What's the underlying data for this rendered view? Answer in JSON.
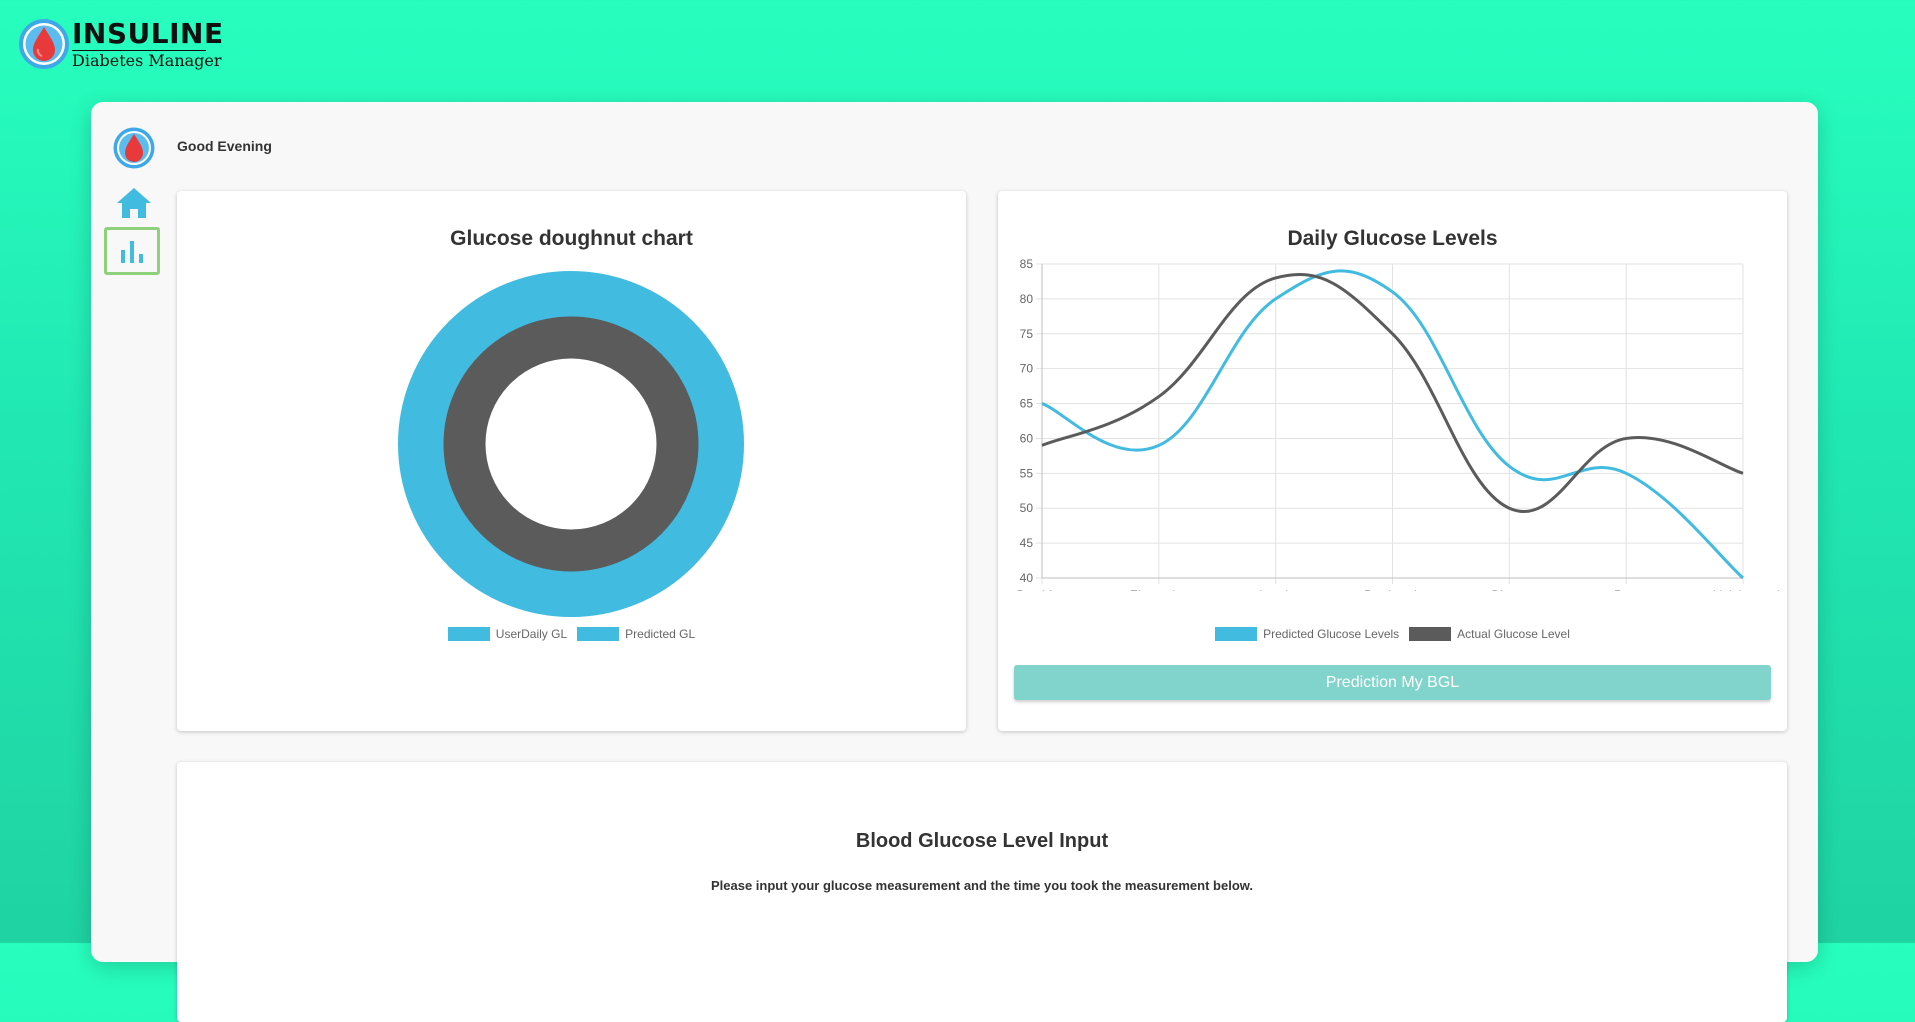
{
  "brand": {
    "title": "INSULINE",
    "subtitle": "Diabetes Manager",
    "logo_icon": "blood-drop-icon"
  },
  "header": {
    "greeting": "Good Evening"
  },
  "nav": [
    {
      "icon": "home-icon",
      "active": false
    },
    {
      "icon": "bar-chart-icon",
      "active": true
    }
  ],
  "colors": {
    "accent": "#41bbdf",
    "dark": "#5b5b5b",
    "button": "#81d4cb",
    "active_border": "#8fd07a"
  },
  "doughnut": {
    "title": "Glucose doughnut chart",
    "legend": [
      "UserDaily GL",
      "Predicted GL"
    ]
  },
  "line_chart": {
    "title": "Daily Glucose Levels",
    "legend": [
      "Predicted Glucose Levels",
      "Actual Glucose Level"
    ]
  },
  "predict_button": "Prediction My BGL",
  "input_section": {
    "title": "Blood Glucose Level Input",
    "subtitle": "Please input your glucose measurement and the time you took the measurement below."
  },
  "chart_data": [
    {
      "type": "pie",
      "title": "Glucose doughnut chart",
      "series": [
        {
          "name": "UserDaily GL",
          "values": [
            1
          ]
        },
        {
          "name": "Predicted GL",
          "values": [
            1
          ]
        }
      ],
      "legend_position": "bottom"
    },
    {
      "type": "line",
      "title": "Daily Glucose Levels",
      "categories": [
        "Breakfast",
        "Elevensies",
        "Lunch",
        "PostLunch",
        "Dinner",
        "Post",
        "midnight snack"
      ],
      "series": [
        {
          "name": "Predicted Glucose Levels",
          "values": [
            65,
            59,
            80,
            81,
            56,
            55,
            40
          ],
          "color": "#41bbdf"
        },
        {
          "name": "Actual Glucose Level",
          "values": [
            59,
            66,
            83,
            75,
            50,
            60,
            55
          ],
          "color": "#5b5b5b"
        }
      ],
      "yticks": [
        40,
        45,
        50,
        55,
        60,
        65,
        70,
        75,
        80,
        85
      ],
      "ylim": [
        40,
        85
      ],
      "grid": true,
      "legend_position": "bottom"
    }
  ]
}
